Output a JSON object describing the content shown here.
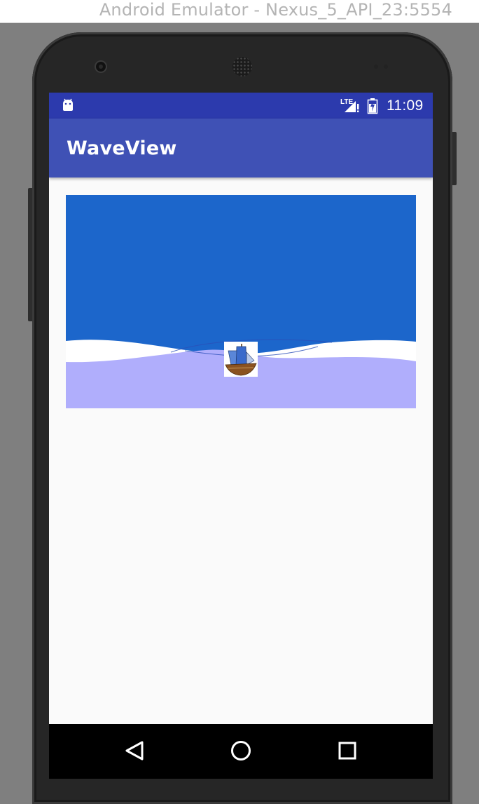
{
  "window": {
    "title": "Android Emulator - Nexus_5_API_23:5554"
  },
  "status_bar": {
    "time": "11:09",
    "network": "LTE",
    "icons": [
      "android-debug-icon",
      "lte-signal-icon",
      "battery-icon"
    ],
    "background": "#2c3aad"
  },
  "app_bar": {
    "title": "WaveView",
    "background": "#3f51b5"
  },
  "wave_view": {
    "sky_color": "#1c66cb",
    "back_wave_color": "#ffffff",
    "front_wave_color": "#b0aefc",
    "boat_icon": "sailing-ship-icon"
  },
  "nav_bar": {
    "buttons": [
      "back-icon",
      "home-icon",
      "recents-icon"
    ]
  }
}
